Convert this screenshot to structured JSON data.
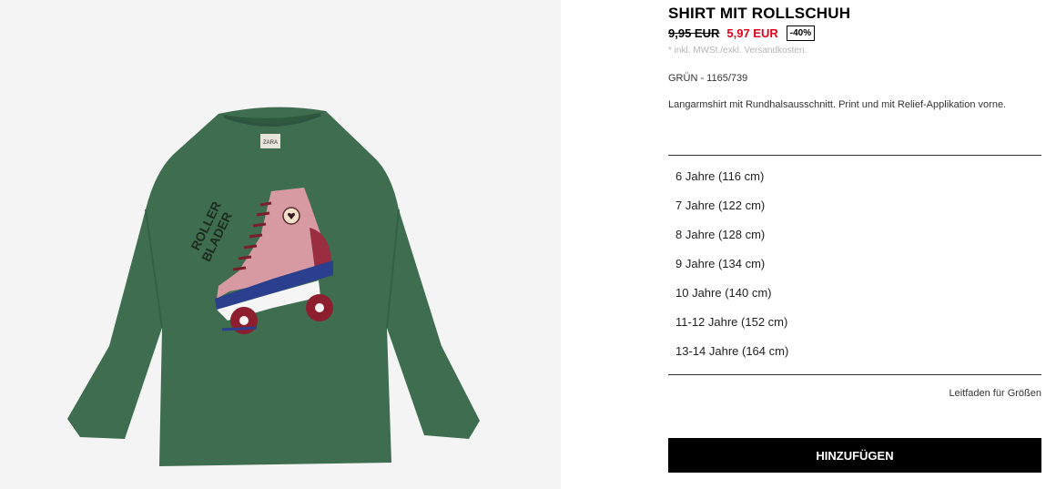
{
  "product": {
    "title": "SHIRT MIT ROLLSCHUH",
    "old_price": "9,95 EUR",
    "new_price": "5,97 EUR",
    "discount": "-40%",
    "tax_note": "* inkl. MWSt./exkl. Versandkosten.",
    "color_ref": "GRÜN - 1165/739",
    "description": "Langarmshirt mit Rundhalsausschnitt. Print und mit Relief-Applikation vorne.",
    "image": {
      "label_text": "ZARA",
      "print_text_line1": "ROLLER",
      "print_text_line2": "BLADER"
    }
  },
  "sizes": [
    {
      "label": "6 Jahre (116 cm)"
    },
    {
      "label": "7 Jahre (122 cm)"
    },
    {
      "label": "8 Jahre (128 cm)"
    },
    {
      "label": "9 Jahre (134 cm)"
    },
    {
      "label": "10 Jahre (140 cm)"
    },
    {
      "label": "11-12 Jahre (152 cm)"
    },
    {
      "label": "13-14 Jahre (164 cm)"
    }
  ],
  "size_guide_label": "Leitfaden für Größen",
  "add_button_label": "HINZUFÜGEN",
  "colors": {
    "sale_red": "#e3001b",
    "shirt_green": "#3e6d4f",
    "button_bg": "#000000"
  }
}
